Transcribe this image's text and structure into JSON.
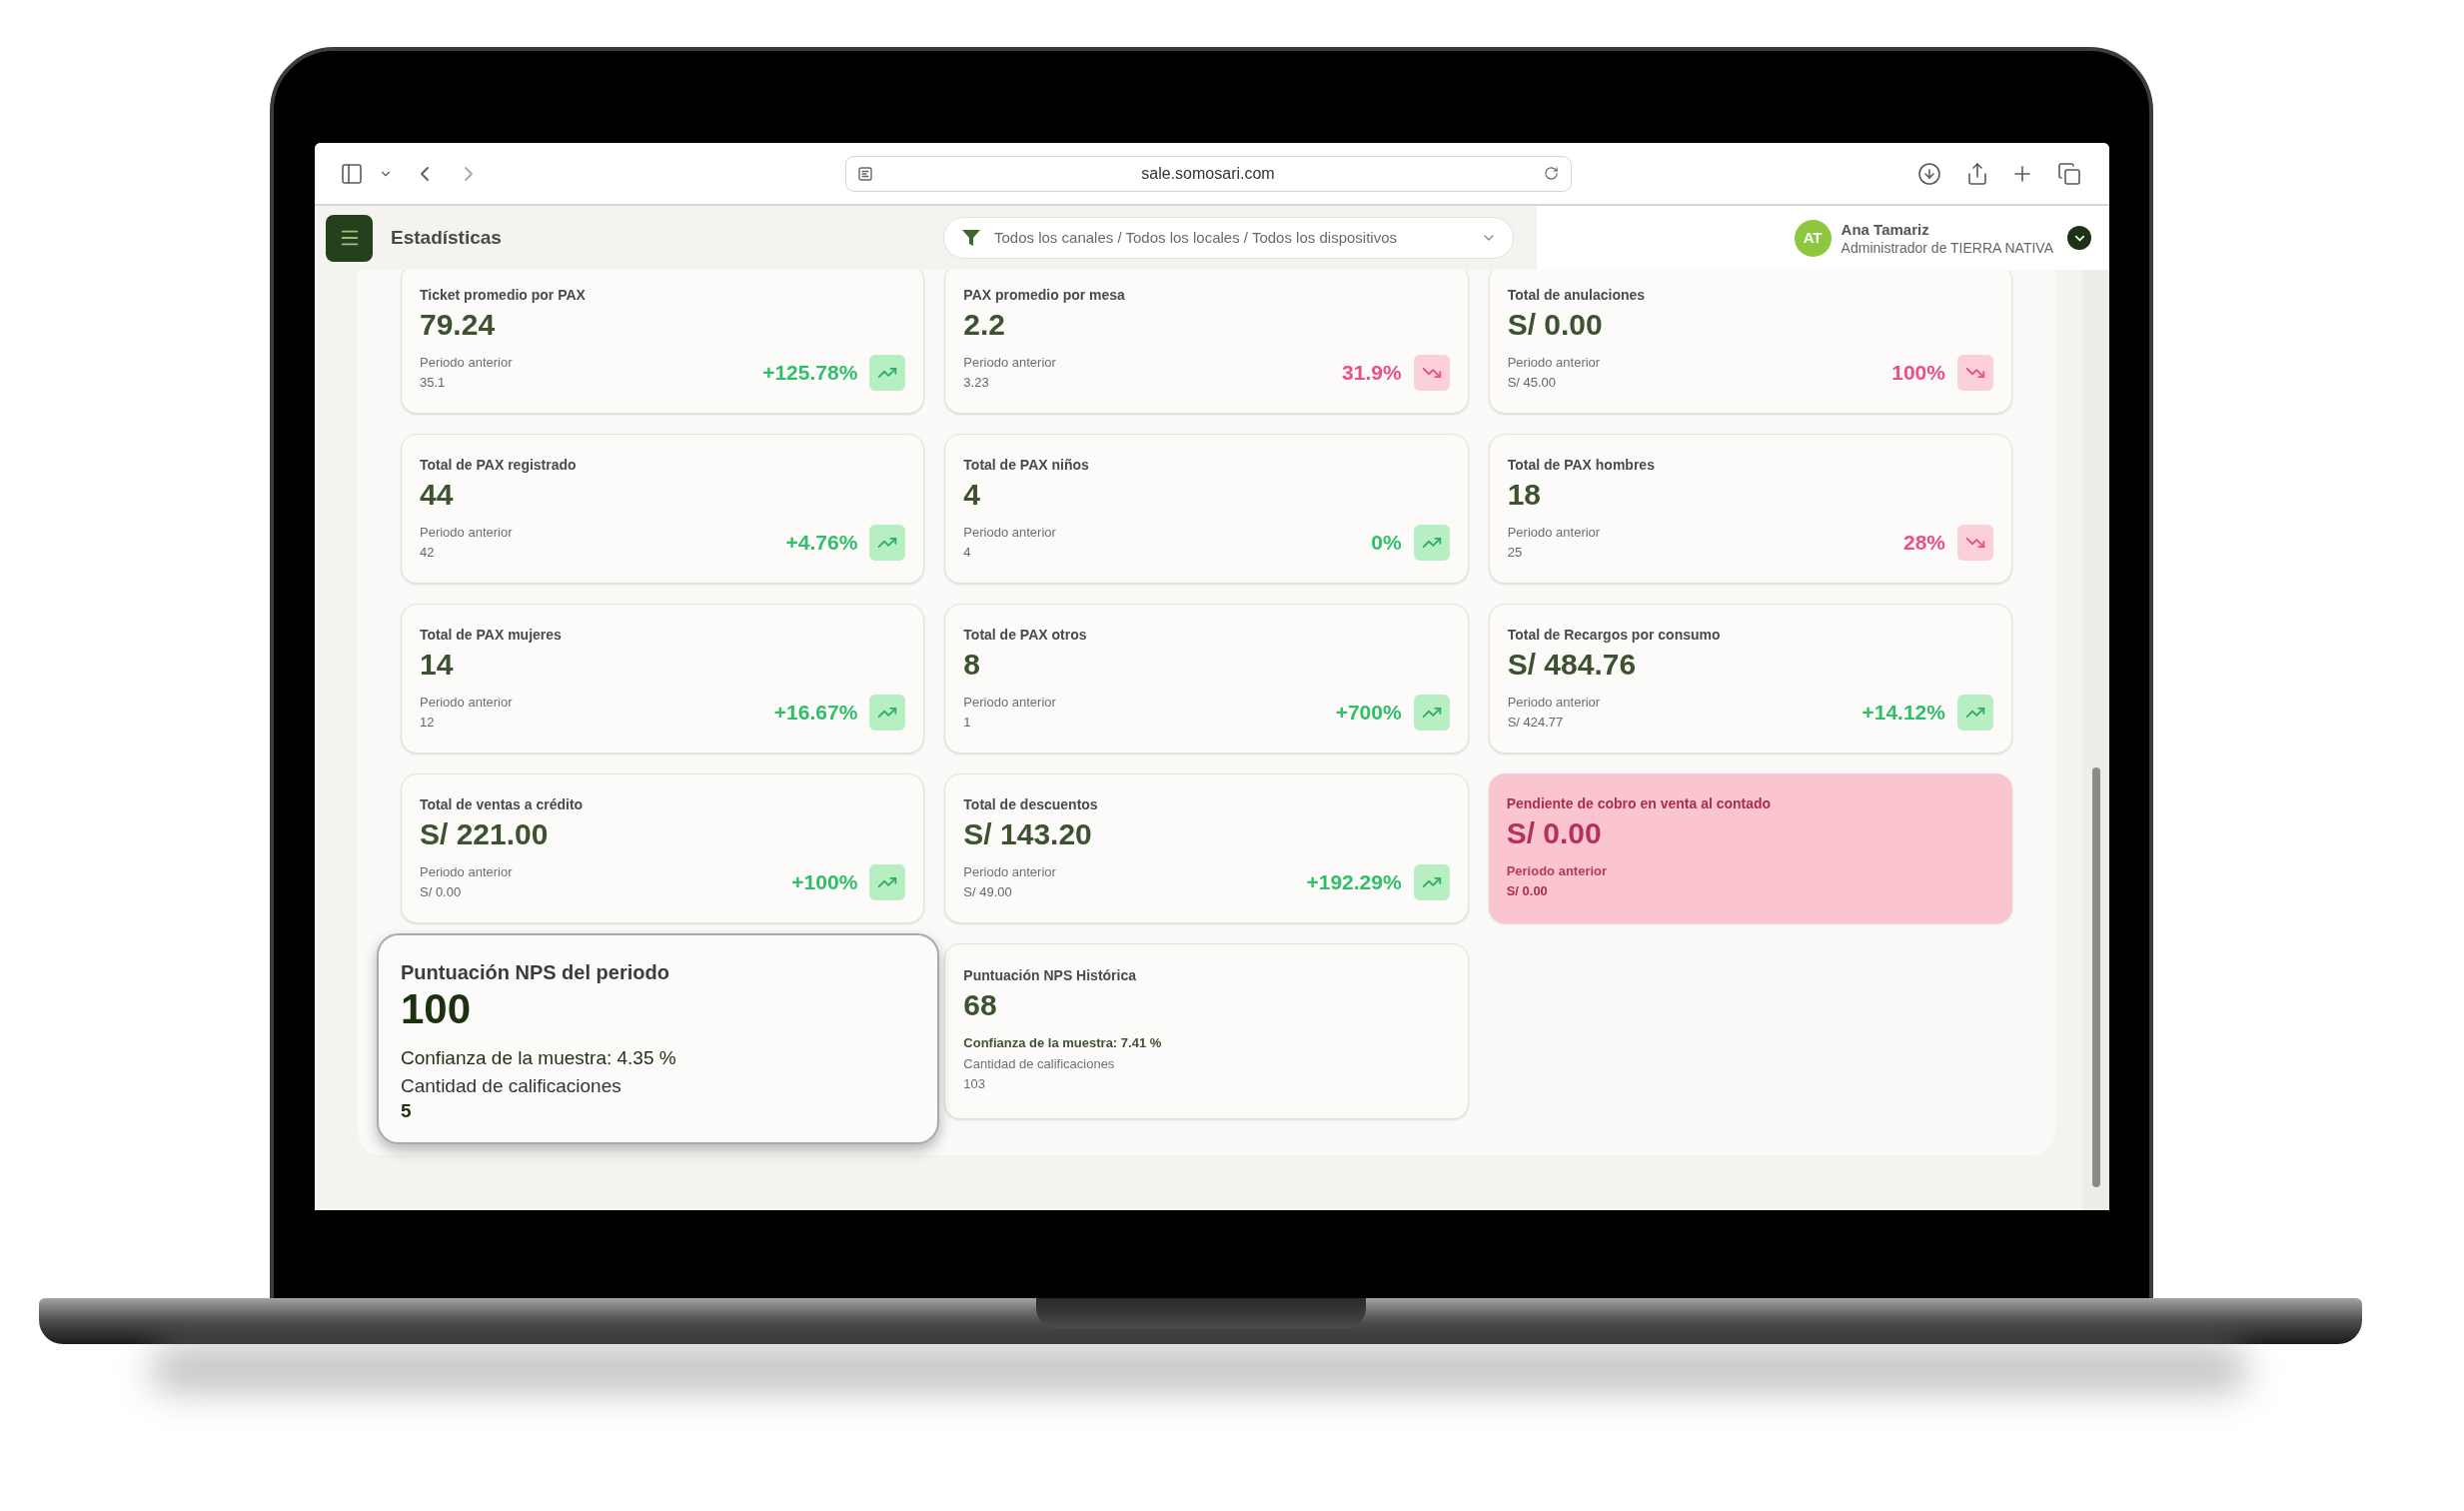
{
  "browser": {
    "url": "sale.somosari.com"
  },
  "header": {
    "title": "Estadísticas",
    "filter": "Todos los canales / Todos los locales / Todos los dispositivos",
    "user": {
      "highlighted": true,
      "initials": "AT",
      "name": "Ana Tamariz",
      "role": "Administrador de TIERRA NATIVA"
    }
  },
  "cards": [
    {
      "kind": "metric",
      "highlighted": false,
      "label": "Ticket promedio por PAX",
      "value": "79.24",
      "previous_label": "Periodo anterior",
      "previous_value": "35.1",
      "change": "+125.78%",
      "rising": true
    },
    {
      "kind": "metric",
      "highlighted": false,
      "label": "PAX promedio por mesa",
      "value": "2.2",
      "previous_label": "Periodo anterior",
      "previous_value": "3.23",
      "change": "31.9%",
      "rising": false
    },
    {
      "kind": "metric",
      "highlighted": false,
      "label": "Total de anulaciones",
      "value": "S/ 0.00",
      "previous_label": "Periodo anterior",
      "previous_value": "S/ 45.00",
      "change": "100%",
      "rising": false
    },
    {
      "kind": "metric",
      "highlighted": false,
      "label": "Total de PAX registrado",
      "value": "44",
      "previous_label": "Periodo anterior",
      "previous_value": "42",
      "change": "+4.76%",
      "rising": true
    },
    {
      "kind": "metric",
      "highlighted": false,
      "label": "Total de PAX niños",
      "value": "4",
      "previous_label": "Periodo anterior",
      "previous_value": "4",
      "change": "0%",
      "rising": true
    },
    {
      "kind": "metric",
      "highlighted": false,
      "label": "Total de PAX hombres",
      "value": "18",
      "previous_label": "Periodo anterior",
      "previous_value": "25",
      "change": "28%",
      "rising": false
    },
    {
      "kind": "metric",
      "highlighted": false,
      "label": "Total de PAX mujeres",
      "value": "14",
      "previous_label": "Periodo anterior",
      "previous_value": "12",
      "change": "+16.67%",
      "rising": true
    },
    {
      "kind": "metric",
      "highlighted": false,
      "label": "Total de PAX otros",
      "value": "8",
      "previous_label": "Periodo anterior",
      "previous_value": "1",
      "change": "+700%",
      "rising": true
    },
    {
      "kind": "metric",
      "highlighted": false,
      "label": "Total de Recargos por consumo",
      "value": "S/ 484.76",
      "previous_label": "Periodo anterior",
      "previous_value": "S/ 424.77",
      "change": "+14.12%",
      "rising": true
    },
    {
      "kind": "metric",
      "highlighted": false,
      "label": "Total de ventas a crédito",
      "value": "S/ 221.00",
      "previous_label": "Periodo anterior",
      "previous_value": "S/ 0.00",
      "change": "+100%",
      "rising": true
    },
    {
      "kind": "metric",
      "highlighted": false,
      "label": "Total de descuentos",
      "value": "S/ 143.20",
      "previous_label": "Periodo anterior",
      "previous_value": "S/ 49.00",
      "change": "+192.29%",
      "rising": true
    },
    {
      "kind": "alert",
      "highlighted": false,
      "label": "Pendiente de cobro en venta al contado",
      "value": "S/ 0.00",
      "previous_label": "Periodo anterior",
      "previous_value": "S/ 0.00"
    },
    {
      "kind": "nps",
      "highlighted": true,
      "label": "Puntuación NPS del periodo",
      "value": "100",
      "confidence": "Confianza de la muestra: 4.35 %",
      "count_label": "Cantidad de calificaciones",
      "count": "5"
    },
    {
      "kind": "nps",
      "highlighted": false,
      "label": "Puntuación NPS Histórica",
      "value": "68",
      "confidence": "Confianza de la muestra: 7.41 %",
      "count_label": "Cantidad de calificaciones",
      "count": "103"
    }
  ]
}
